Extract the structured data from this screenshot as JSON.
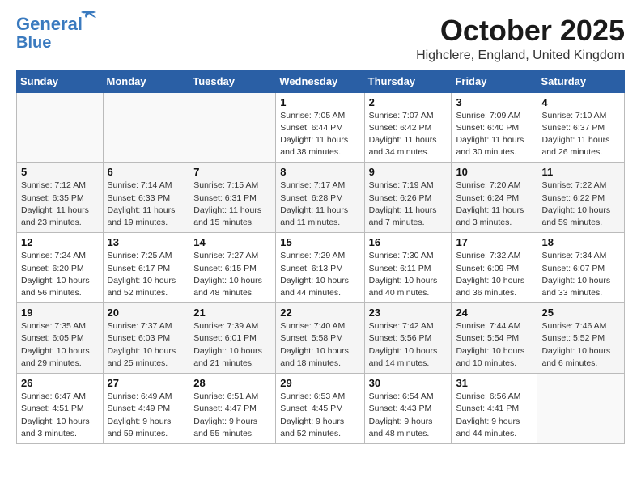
{
  "logo": {
    "line1": "General",
    "line2": "Blue"
  },
  "title": "October 2025",
  "subtitle": "Highclere, England, United Kingdom",
  "weekdays": [
    "Sunday",
    "Monday",
    "Tuesday",
    "Wednesday",
    "Thursday",
    "Friday",
    "Saturday"
  ],
  "weeks": [
    [
      {
        "day": "",
        "info": ""
      },
      {
        "day": "",
        "info": ""
      },
      {
        "day": "",
        "info": ""
      },
      {
        "day": "1",
        "info": "Sunrise: 7:05 AM\nSunset: 6:44 PM\nDaylight: 11 hours\nand 38 minutes."
      },
      {
        "day": "2",
        "info": "Sunrise: 7:07 AM\nSunset: 6:42 PM\nDaylight: 11 hours\nand 34 minutes."
      },
      {
        "day": "3",
        "info": "Sunrise: 7:09 AM\nSunset: 6:40 PM\nDaylight: 11 hours\nand 30 minutes."
      },
      {
        "day": "4",
        "info": "Sunrise: 7:10 AM\nSunset: 6:37 PM\nDaylight: 11 hours\nand 26 minutes."
      }
    ],
    [
      {
        "day": "5",
        "info": "Sunrise: 7:12 AM\nSunset: 6:35 PM\nDaylight: 11 hours\nand 23 minutes."
      },
      {
        "day": "6",
        "info": "Sunrise: 7:14 AM\nSunset: 6:33 PM\nDaylight: 11 hours\nand 19 minutes."
      },
      {
        "day": "7",
        "info": "Sunrise: 7:15 AM\nSunset: 6:31 PM\nDaylight: 11 hours\nand 15 minutes."
      },
      {
        "day": "8",
        "info": "Sunrise: 7:17 AM\nSunset: 6:28 PM\nDaylight: 11 hours\nand 11 minutes."
      },
      {
        "day": "9",
        "info": "Sunrise: 7:19 AM\nSunset: 6:26 PM\nDaylight: 11 hours\nand 7 minutes."
      },
      {
        "day": "10",
        "info": "Sunrise: 7:20 AM\nSunset: 6:24 PM\nDaylight: 11 hours\nand 3 minutes."
      },
      {
        "day": "11",
        "info": "Sunrise: 7:22 AM\nSunset: 6:22 PM\nDaylight: 10 hours\nand 59 minutes."
      }
    ],
    [
      {
        "day": "12",
        "info": "Sunrise: 7:24 AM\nSunset: 6:20 PM\nDaylight: 10 hours\nand 56 minutes."
      },
      {
        "day": "13",
        "info": "Sunrise: 7:25 AM\nSunset: 6:17 PM\nDaylight: 10 hours\nand 52 minutes."
      },
      {
        "day": "14",
        "info": "Sunrise: 7:27 AM\nSunset: 6:15 PM\nDaylight: 10 hours\nand 48 minutes."
      },
      {
        "day": "15",
        "info": "Sunrise: 7:29 AM\nSunset: 6:13 PM\nDaylight: 10 hours\nand 44 minutes."
      },
      {
        "day": "16",
        "info": "Sunrise: 7:30 AM\nSunset: 6:11 PM\nDaylight: 10 hours\nand 40 minutes."
      },
      {
        "day": "17",
        "info": "Sunrise: 7:32 AM\nSunset: 6:09 PM\nDaylight: 10 hours\nand 36 minutes."
      },
      {
        "day": "18",
        "info": "Sunrise: 7:34 AM\nSunset: 6:07 PM\nDaylight: 10 hours\nand 33 minutes."
      }
    ],
    [
      {
        "day": "19",
        "info": "Sunrise: 7:35 AM\nSunset: 6:05 PM\nDaylight: 10 hours\nand 29 minutes."
      },
      {
        "day": "20",
        "info": "Sunrise: 7:37 AM\nSunset: 6:03 PM\nDaylight: 10 hours\nand 25 minutes."
      },
      {
        "day": "21",
        "info": "Sunrise: 7:39 AM\nSunset: 6:01 PM\nDaylight: 10 hours\nand 21 minutes."
      },
      {
        "day": "22",
        "info": "Sunrise: 7:40 AM\nSunset: 5:58 PM\nDaylight: 10 hours\nand 18 minutes."
      },
      {
        "day": "23",
        "info": "Sunrise: 7:42 AM\nSunset: 5:56 PM\nDaylight: 10 hours\nand 14 minutes."
      },
      {
        "day": "24",
        "info": "Sunrise: 7:44 AM\nSunset: 5:54 PM\nDaylight: 10 hours\nand 10 minutes."
      },
      {
        "day": "25",
        "info": "Sunrise: 7:46 AM\nSunset: 5:52 PM\nDaylight: 10 hours\nand 6 minutes."
      }
    ],
    [
      {
        "day": "26",
        "info": "Sunrise: 6:47 AM\nSunset: 4:51 PM\nDaylight: 10 hours\nand 3 minutes."
      },
      {
        "day": "27",
        "info": "Sunrise: 6:49 AM\nSunset: 4:49 PM\nDaylight: 9 hours\nand 59 minutes."
      },
      {
        "day": "28",
        "info": "Sunrise: 6:51 AM\nSunset: 4:47 PM\nDaylight: 9 hours\nand 55 minutes."
      },
      {
        "day": "29",
        "info": "Sunrise: 6:53 AM\nSunset: 4:45 PM\nDaylight: 9 hours\nand 52 minutes."
      },
      {
        "day": "30",
        "info": "Sunrise: 6:54 AM\nSunset: 4:43 PM\nDaylight: 9 hours\nand 48 minutes."
      },
      {
        "day": "31",
        "info": "Sunrise: 6:56 AM\nSunset: 4:41 PM\nDaylight: 9 hours\nand 44 minutes."
      },
      {
        "day": "",
        "info": ""
      }
    ]
  ]
}
